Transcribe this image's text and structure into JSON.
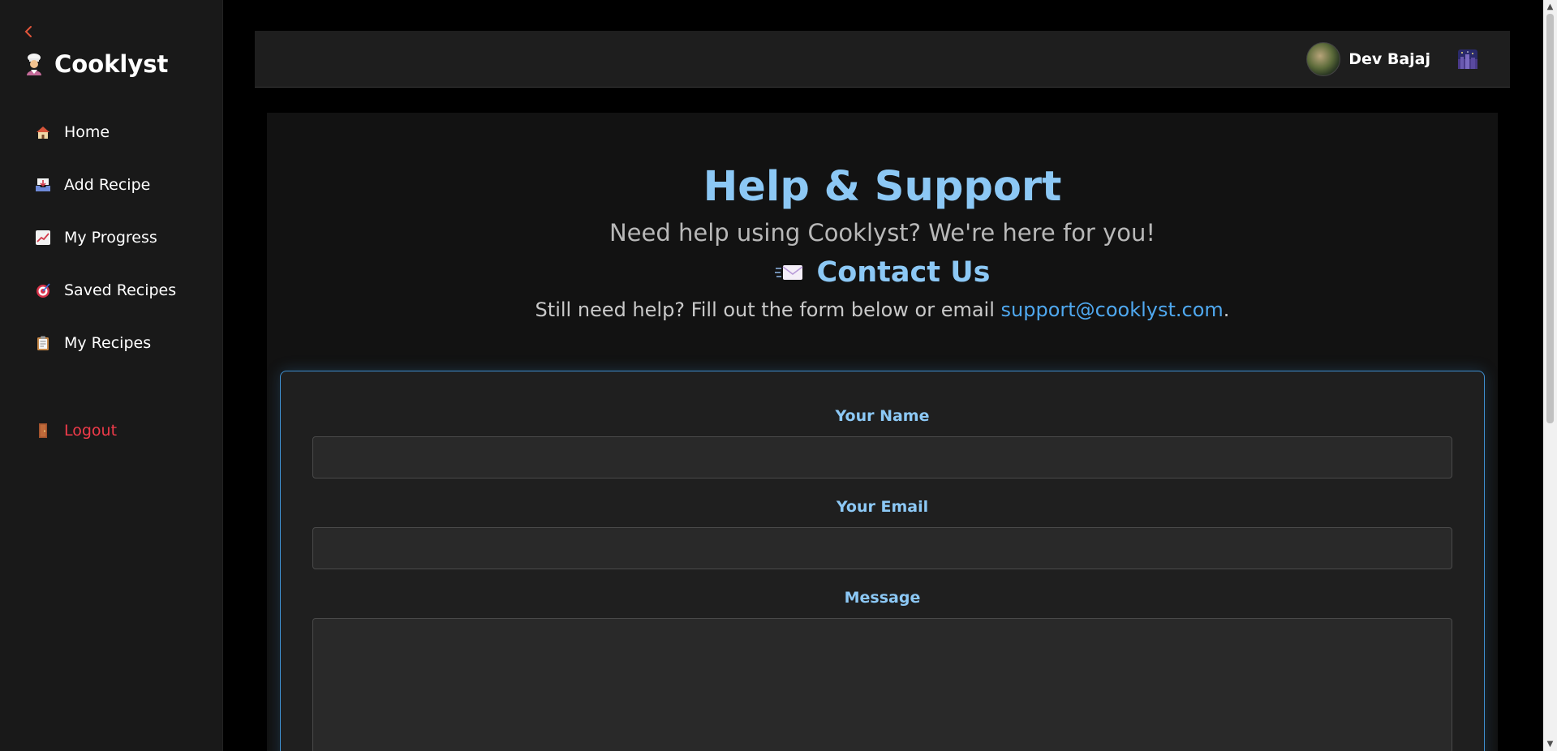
{
  "sidebar": {
    "brand": "Cooklyst",
    "brand_icon": "chef-icon",
    "back_icon": "chevron-left-icon",
    "items": [
      {
        "label": "Home",
        "icon": "house-icon"
      },
      {
        "label": "Add Recipe",
        "icon": "inbox-tray-icon"
      },
      {
        "label": "My Progress",
        "icon": "chart-increasing-icon"
      },
      {
        "label": "Saved Recipes",
        "icon": "target-icon"
      },
      {
        "label": "My Recipes",
        "icon": "clipboard-icon"
      }
    ],
    "logout": {
      "label": "Logout",
      "icon": "door-icon"
    }
  },
  "header": {
    "user_name": "Dev Bajaj",
    "theme_icon": "night-city-icon"
  },
  "main": {
    "title": "Help & Support",
    "subtitle": "Need help using Cooklyst? We're here for you!",
    "contact_title": "Contact Us",
    "contact_icon": "incoming-envelope-icon",
    "help_prefix": "Still need help? Fill out the form below or email ",
    "support_email": "support@cooklyst.com",
    "help_suffix": "."
  },
  "form": {
    "name_label": "Your Name",
    "name_value": "",
    "email_label": "Your Email",
    "email_value": "",
    "message_label": "Message",
    "message_value": ""
  },
  "colors": {
    "accent": "#8cc8f5",
    "link": "#4fa8ef",
    "logout": "#f03b4a",
    "back": "#e2553a",
    "card_border": "#3f8fd0"
  }
}
